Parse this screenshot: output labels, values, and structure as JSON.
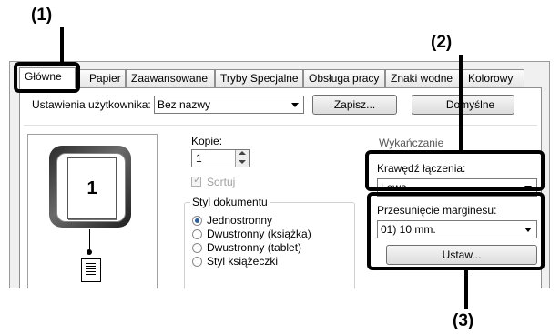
{
  "callouts": {
    "c1": "(1)",
    "c2": "(2)",
    "c3": "(3)"
  },
  "tabs": [
    "Główne",
    "Papier",
    "Zaawansowane",
    "Tryby Specjalne",
    "Obsługa pracy",
    "Znaki wodne",
    "Kolorowy"
  ],
  "user_settings": {
    "label": "Ustawienia użytkownika:",
    "value": "Bez nazwy",
    "save_label": "Zapisz...",
    "default_label": "Domyślne"
  },
  "preview": {
    "page_number": "1"
  },
  "copies": {
    "label": "Kopie:",
    "value": "1"
  },
  "collate": {
    "label": "Sortuj",
    "checked": true,
    "enabled": false
  },
  "document_style": {
    "label": "Styl dokumentu",
    "options": [
      "Jednostronny",
      "Dwustronny (książka)",
      "Dwustronny (tablet)",
      "Styl książeczki"
    ],
    "selected": "Jednostronny"
  },
  "obscured_label": "Wykańczanie",
  "binding_edge": {
    "label": "Krawędź łączenia:",
    "value": "Lewa"
  },
  "margin_shift": {
    "label": "Przesunięcie marginesu:",
    "value": "01) 10 mm.",
    "settings_label": "Ustaw..."
  },
  "colors": {
    "radio_accent": "#2b5d9c",
    "callout_frame": "#000000",
    "disabled_text": "#a0a0a0"
  }
}
